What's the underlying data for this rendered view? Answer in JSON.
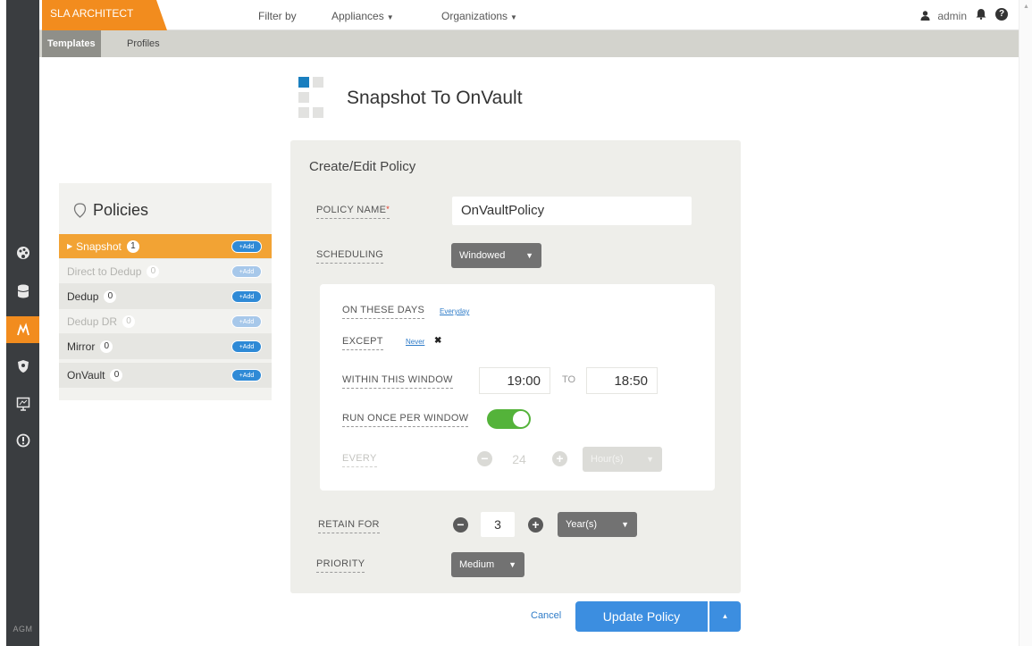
{
  "app": {
    "brand": "SLA ARCHITECT",
    "footer": "AGM"
  },
  "topbar": {
    "filter_by": "Filter by",
    "appliances": "Appliances",
    "organizations": "Organizations",
    "user": "admin"
  },
  "tabs": [
    "Templates",
    "Profiles"
  ],
  "template": {
    "title": "Snapshot To OnVault"
  },
  "policies": {
    "title": "Policies",
    "add_label": "+Add",
    "items": [
      {
        "label": "Snapshot",
        "count": "1",
        "state": "selected"
      },
      {
        "label": "Direct to Dedup",
        "count": "0",
        "state": "disabled"
      },
      {
        "label": "Dedup",
        "count": "0",
        "state": "enabled"
      },
      {
        "label": "Dedup DR",
        "count": "0",
        "state": "disabled"
      },
      {
        "label": "Mirror",
        "count": "0",
        "state": "enabled"
      },
      {
        "label": "OnVault",
        "count": "0",
        "state": "enabled"
      }
    ]
  },
  "form": {
    "title": "Create/Edit Policy",
    "policy_name_label": "POLICY NAME",
    "policy_name_required": "*",
    "policy_name_value": "OnVaultPolicy",
    "scheduling_label": "SCHEDULING",
    "scheduling_value": "Windowed",
    "on_these_days_label": "ON THESE DAYS",
    "on_these_days_value": "Everyday",
    "except_label": "EXCEPT",
    "except_value": "Never",
    "window_label": "WITHIN THIS WINDOW",
    "window_start": "19:00",
    "window_to": "TO",
    "window_end": "18:50",
    "run_once_label": "RUN ONCE PER WINDOW",
    "run_once_on": true,
    "every_label": "EVERY",
    "every_value": "24",
    "every_unit": "Hour(s)",
    "retain_label": "RETAIN FOR",
    "retain_value": "3",
    "retain_unit": "Year(s)",
    "priority_label": "PRIORITY",
    "priority_value": "Medium"
  },
  "actions": {
    "cancel": "Cancel",
    "update": "Update Policy"
  },
  "colors": {
    "accent": "#f28c1e",
    "primary": "#3c8ee0",
    "toggle_on": "#54b33a"
  }
}
